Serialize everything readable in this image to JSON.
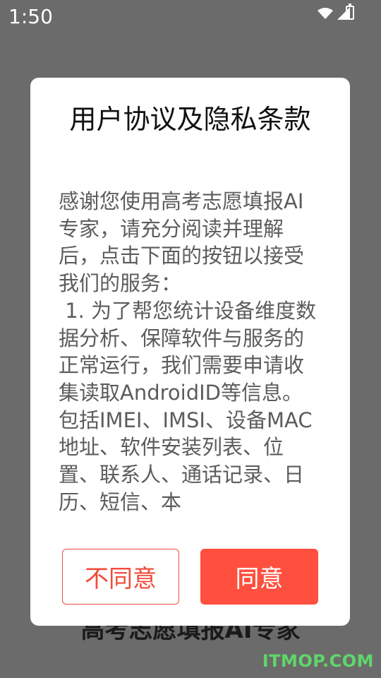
{
  "status_bar": {
    "time": "1:50",
    "icons": [
      "wifi-icon",
      "cellular-signal-icon",
      "battery-icon"
    ]
  },
  "background": {
    "app_title": "高考志愿填报AI专家",
    "watermark": "ITMOP.COM"
  },
  "dialog": {
    "title": "用户协议及隐私条款",
    "body": "感谢您使用高考志愿填报AI专家，请充分阅读并理解后，点击下面的按钮以接受我们的服务：\n 1. 为了帮您统计设备维度数据分析、保障软件与服务的正常运行，我们需要申请收集读取AndroidID等信息。包括IMEI、IMSI、设备MAC地址、软件安装列表、位置、联系人、通话记录、日历、短信、本",
    "disagree_label": "不同意",
    "agree_label": "同意"
  },
  "colors": {
    "accent": "#ff4f3e",
    "overlay": "#6b6b6b",
    "dialog_bg": "#ffffff",
    "body_text": "#5c5c5c",
    "watermark": "#5fd66a"
  }
}
